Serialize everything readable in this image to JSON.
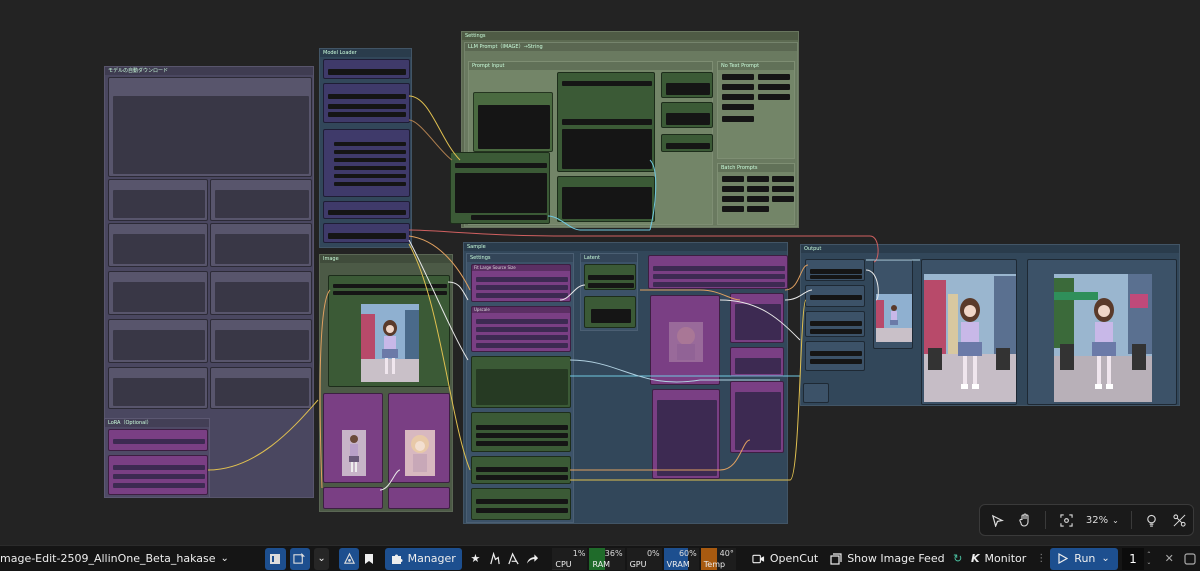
{
  "groups": {
    "model_download": "モデルの自動ダウンロード",
    "model_loader": "Model Loader",
    "settings": "Settings",
    "llm_prompt": "LLM Prompt（IMAGE）→String",
    "prompt_input": "Prompt Input",
    "no_text_prompt": "No Text Prompt",
    "batch_prompt": "Batch Prompts",
    "image": "Image",
    "lora": "LoRA（Optional）",
    "sample": "Sample",
    "settings2": "Settings",
    "latent": "Latent",
    "fit_large": "Fit Large Source Size",
    "upscale": "Upscale",
    "output": "Output"
  },
  "canvas": {
    "zoom": "32%",
    "tools": [
      "select-icon",
      "hand-icon",
      "fit-view-icon",
      "bulb-icon",
      "link-visibility-icon"
    ]
  },
  "bottombar": {
    "workflow_name": "mage-Edit-2509_AllinOne_Beta_hakase",
    "manager_label": "Manager",
    "stats": [
      {
        "label": "CPU",
        "value": "1%",
        "fill": 0.01,
        "color": "#2a2a2a"
      },
      {
        "label": "RAM",
        "value": "36%",
        "fill": 0.36,
        "color": "#1f6b2a"
      },
      {
        "label": "GPU",
        "value": "0%",
        "fill": 0.0,
        "color": "#2a2a2a"
      },
      {
        "label": "VRAM",
        "value": "60%",
        "fill": 0.6,
        "color": "#1d4f8f"
      },
      {
        "label": "Temp",
        "value": "40°",
        "fill": 0.4,
        "color": "#a85a10"
      }
    ],
    "opencut_label": "OpenCut",
    "show_image_feed_label": "Show Image Feed",
    "monitor_label": "Monitor",
    "run_label": "Run",
    "run_count": "1"
  },
  "colors": {
    "canvas_bg": "#232323",
    "group_purple": "#4a4760",
    "group_slate": "#32475a",
    "group_sage": "#5d6b52",
    "node_green": "#3b5a36",
    "node_magenta": "#7a3f84",
    "node_violet": "#3f3a6a",
    "accent_blue": "#1d4f8f"
  }
}
